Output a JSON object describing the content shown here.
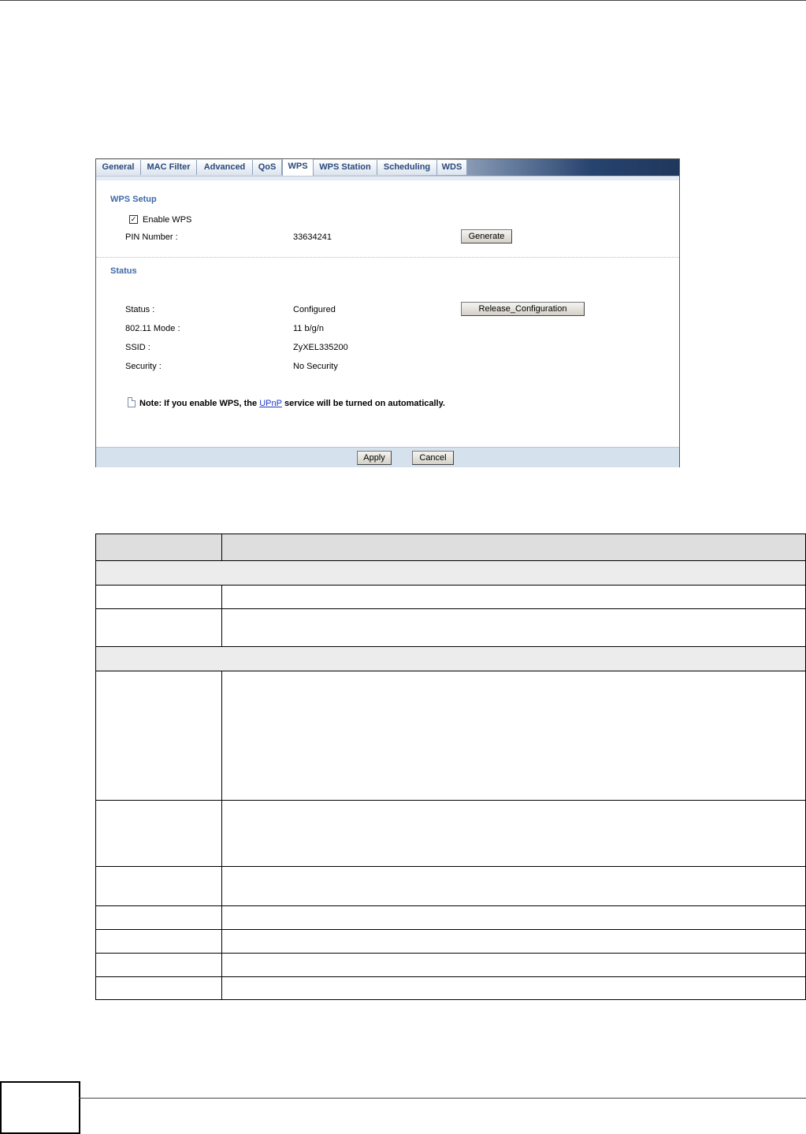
{
  "tabs": [
    {
      "label": "General",
      "active": false
    },
    {
      "label": "MAC Filter",
      "active": false
    },
    {
      "label": "Advanced",
      "active": false
    },
    {
      "label": "QoS",
      "active": false
    },
    {
      "label": "WPS",
      "active": true
    },
    {
      "label": "WPS Station",
      "active": false
    },
    {
      "label": "Scheduling",
      "active": false
    },
    {
      "label": "WDS",
      "active": false
    }
  ],
  "wps_setup": {
    "title": "WPS Setup",
    "enable_label": "Enable WPS",
    "enable_checked": true,
    "pin_label": "PIN Number :",
    "pin_value": "33634241",
    "generate_button": "Generate"
  },
  "status": {
    "title": "Status",
    "release_button": "Release_Configuration",
    "rows": [
      {
        "label": "Status :",
        "value": "Configured"
      },
      {
        "label": "802.11 Mode :",
        "value": "11 b/g/n"
      },
      {
        "label": "SSID :",
        "value": "ZyXEL335200"
      },
      {
        "label": "Security :",
        "value": "No Security"
      }
    ]
  },
  "note": {
    "prefix": "Note: If you enable WPS, the ",
    "link": "UPnP",
    "suffix": " service will be turned on automatically."
  },
  "footer": {
    "apply_button": "Apply",
    "cancel_button": "Cancel"
  },
  "colors": {
    "section_title": "#3d6aa8",
    "tab_text": "#2a4a7a",
    "footer_bg": "#d6e1ee",
    "link": "#1f37c7"
  }
}
